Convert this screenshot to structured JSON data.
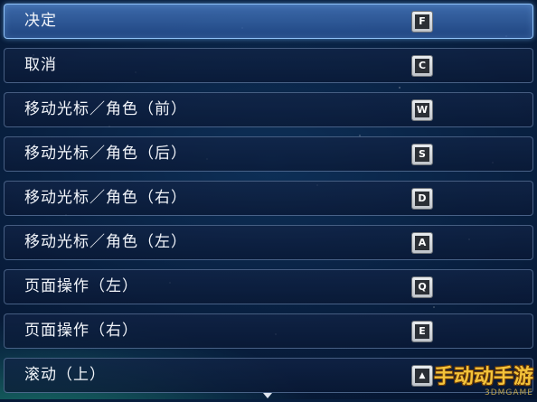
{
  "menu": {
    "items": [
      {
        "label": "决定",
        "key": "F",
        "selected": true
      },
      {
        "label": "取消",
        "key": "C",
        "selected": false
      },
      {
        "label": "移动光标／角色（前）",
        "key": "W",
        "selected": false
      },
      {
        "label": "移动光标／角色（后）",
        "key": "S",
        "selected": false
      },
      {
        "label": "移动光标／角色（右）",
        "key": "D",
        "selected": false
      },
      {
        "label": "移动光标／角色（左）",
        "key": "A",
        "selected": false
      },
      {
        "label": "页面操作（左）",
        "key": "Q",
        "selected": false
      },
      {
        "label": "页面操作（右）",
        "key": "E",
        "selected": false
      },
      {
        "label": "滚动（上）",
        "key": "▲",
        "selected": false
      }
    ]
  },
  "watermark": {
    "text": "手动动手游",
    "sub": "3DMGAME"
  },
  "colors": {
    "selected_row": "#3c6fb0",
    "row_bg": "#0f2143",
    "row_border": "#7896be",
    "label_text": "#f2f5fa",
    "key_face": "#2b2f35",
    "watermark": "#f3c23a"
  }
}
